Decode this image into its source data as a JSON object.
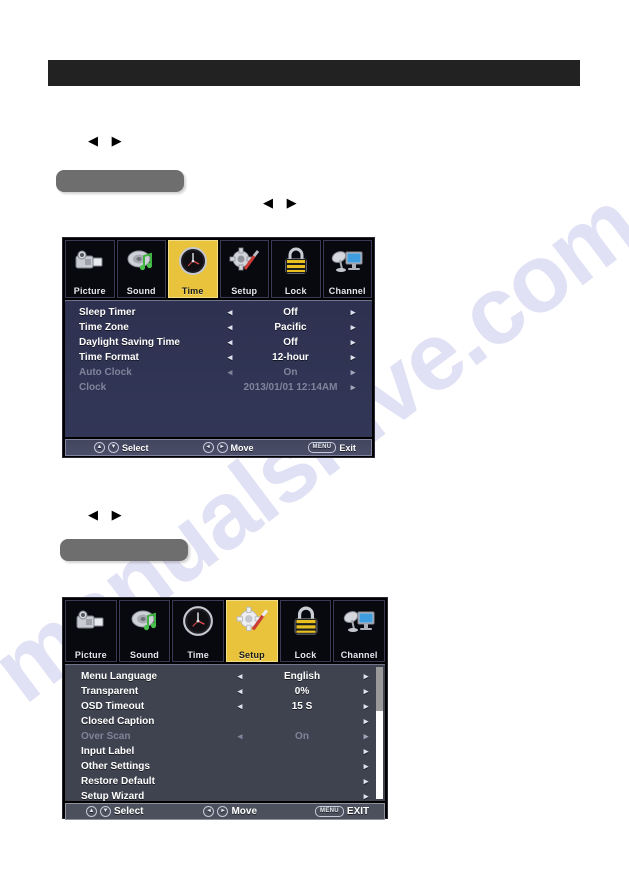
{
  "page": {
    "watermark": "manualshive.com",
    "top_bar_redacted": true,
    "redaction_blocks": [
      "gray-rounded-block-1",
      "gray-rounded-block-2"
    ],
    "inline_arrow_pairs": [
      "◀ ▶",
      "◀ ▶",
      "◀ ▶"
    ]
  },
  "glyphs": {
    "left_arrow": "◀",
    "right_arrow": "▶",
    "left_nav": "◂",
    "right_nav": "▸",
    "up_key": "▲",
    "down_key": "▼"
  },
  "colors": {
    "highlight": "#e8c33b",
    "panel_time": "#2e3150",
    "panel_setup": "#3f4350",
    "footer": "#4a4e60",
    "text": "#ffffff",
    "text_disabled": "#80849a",
    "top_bar": "#222222",
    "redaction_gray": "#6e6e6e",
    "watermark": "#c9c9ee"
  },
  "time_menu": {
    "name": "Time",
    "tabs": [
      {
        "label": "Picture",
        "icon": "camcorder-icon",
        "active": false
      },
      {
        "label": "Sound",
        "icon": "speaker-music-note-icon",
        "active": false
      },
      {
        "label": "Time",
        "icon": "clock-icon",
        "active": true
      },
      {
        "label": "Setup",
        "icon": "gear-screwdriver-icon",
        "active": false
      },
      {
        "label": "Lock",
        "icon": "padlock-icon",
        "active": false
      },
      {
        "label": "Channel",
        "icon": "satellite-monitor-icon",
        "active": false
      }
    ],
    "rows": [
      {
        "label": "Sleep Timer",
        "value": "Off",
        "left_arrow": true,
        "right_arrow": true,
        "disabled": false
      },
      {
        "label": "Time Zone",
        "value": "Pacific",
        "left_arrow": true,
        "right_arrow": true,
        "disabled": false
      },
      {
        "label": "Daylight Saving Time",
        "value": "Off",
        "left_arrow": true,
        "right_arrow": true,
        "disabled": false
      },
      {
        "label": "Time Format",
        "value": "12-hour",
        "left_arrow": true,
        "right_arrow": true,
        "disabled": false
      },
      {
        "label": "Auto Clock",
        "value": "On",
        "left_arrow": true,
        "right_arrow": true,
        "disabled": true
      },
      {
        "label": "Clock",
        "value": "2013/01/01 12:14AM",
        "left_arrow": false,
        "right_arrow": true,
        "disabled": true
      }
    ],
    "footer": {
      "select_label": "Select",
      "move_label": "Move",
      "exit_label": "Exit",
      "menu_key": "MENU"
    },
    "scrollbar": false
  },
  "setup_menu": {
    "name": "Setup",
    "tabs": [
      {
        "label": "Picture",
        "icon": "camcorder-icon",
        "active": false
      },
      {
        "label": "Sound",
        "icon": "speaker-music-note-icon",
        "active": false
      },
      {
        "label": "Time",
        "icon": "clock-icon",
        "active": false
      },
      {
        "label": "Setup",
        "icon": "gear-screwdriver-icon",
        "active": true
      },
      {
        "label": "Lock",
        "icon": "padlock-icon",
        "active": false
      },
      {
        "label": "Channel",
        "icon": "satellite-monitor-icon",
        "active": false
      }
    ],
    "rows": [
      {
        "label": "Menu Language",
        "value": "English",
        "left_arrow": true,
        "right_arrow": true,
        "disabled": false
      },
      {
        "label": "Transparent",
        "value": "0%",
        "left_arrow": true,
        "right_arrow": true,
        "disabled": false
      },
      {
        "label": "OSD Timeout",
        "value": "15 S",
        "left_arrow": true,
        "right_arrow": true,
        "disabled": false
      },
      {
        "label": "Closed Caption",
        "value": "",
        "left_arrow": false,
        "right_arrow": true,
        "disabled": false
      },
      {
        "label": "Over Scan",
        "value": "On",
        "left_arrow": true,
        "right_arrow": true,
        "disabled": true
      },
      {
        "label": "Input Label",
        "value": "",
        "left_arrow": false,
        "right_arrow": true,
        "disabled": false
      },
      {
        "label": "Other Settings",
        "value": "",
        "left_arrow": false,
        "right_arrow": true,
        "disabled": false
      },
      {
        "label": "Restore Default",
        "value": "",
        "left_arrow": false,
        "right_arrow": true,
        "disabled": false
      },
      {
        "label": "Setup Wizard",
        "value": "",
        "left_arrow": false,
        "right_arrow": true,
        "disabled": false
      }
    ],
    "footer": {
      "select_label": "Select",
      "move_label": "Move",
      "exit_label": "EXIT",
      "menu_key": "MENU"
    },
    "scrollbar": true
  }
}
